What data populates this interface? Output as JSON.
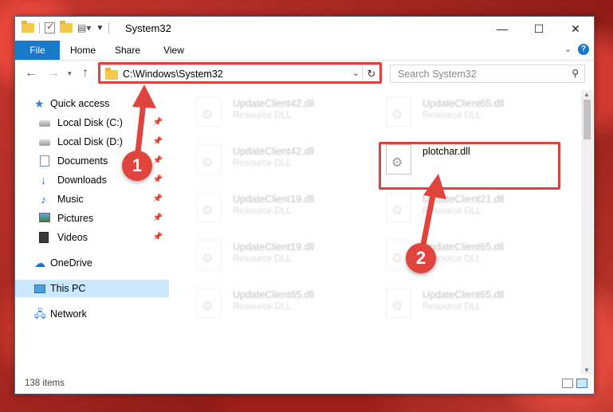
{
  "window": {
    "title": "System32"
  },
  "ribbon": {
    "tabs": [
      "File",
      "Home",
      "Share",
      "View"
    ]
  },
  "address": {
    "path": "C:\\Windows\\System32"
  },
  "search": {
    "placeholder": "Search System32"
  },
  "sidebar": {
    "items": [
      {
        "label": "Quick access",
        "icon": "star-icon"
      },
      {
        "label": "Local Disk (C:)",
        "icon": "disk-icon",
        "pinned": true
      },
      {
        "label": "Local Disk (D:)",
        "icon": "disk-icon",
        "pinned": true
      },
      {
        "label": "Documents",
        "icon": "document-icon",
        "pinned": true
      },
      {
        "label": "Downloads",
        "icon": "download-icon",
        "pinned": true
      },
      {
        "label": "Music",
        "icon": "music-icon",
        "pinned": true
      },
      {
        "label": "Pictures",
        "icon": "picture-icon",
        "pinned": true
      },
      {
        "label": "Videos",
        "icon": "video-icon",
        "pinned": true
      },
      {
        "label": "OneDrive",
        "icon": "cloud-icon"
      },
      {
        "label": "This PC",
        "icon": "computer-icon",
        "selected": true
      },
      {
        "label": "Network",
        "icon": "network-icon"
      }
    ]
  },
  "files": [
    {
      "name": "UpdateClient42.dll",
      "type": "Resource DLL"
    },
    {
      "name": "UpdateClient65.dll",
      "type": "Resource DLL"
    },
    {
      "name": "UpdateClient42.dll",
      "type": "Resource DLL"
    },
    {
      "name": "plotchar.dll",
      "type": ""
    },
    {
      "name": "UpdateClient19.dll",
      "type": "Resource DLL"
    },
    {
      "name": "UpdateClient21.dll",
      "type": "Resource DLL"
    },
    {
      "name": "UpdateClient19.dll",
      "type": "Resource DLL"
    },
    {
      "name": "UpdateClient65.dll",
      "type": "Resource DLL"
    },
    {
      "name": "UpdateClient65.dll",
      "type": "Resource DLL"
    },
    {
      "name": "UpdateClient65.dll",
      "type": "Resource DLL"
    }
  ],
  "status": {
    "item_count": "138 items"
  },
  "annotations": {
    "step1": "1",
    "step2": "2"
  },
  "colors": {
    "accent": "#1979ca",
    "highlight": "#e04040",
    "selected": "#cce8ff"
  }
}
